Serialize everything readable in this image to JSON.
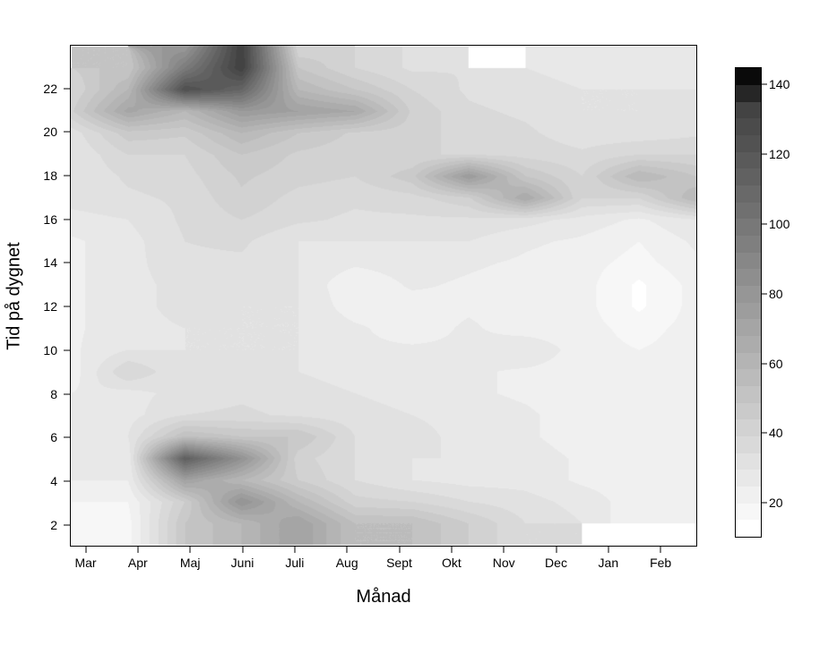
{
  "chart_data": {
    "type": "heatmap",
    "title": "",
    "xlabel": "Månad",
    "ylabel": "Tid på dygnet",
    "x_categories": [
      "Mar",
      "Apr",
      "Maj",
      "Juni",
      "Juli",
      "Aug",
      "Sept",
      "Okt",
      "Nov",
      "Dec",
      "Jan",
      "Feb"
    ],
    "y_ticks": [
      2,
      4,
      6,
      8,
      10,
      12,
      14,
      16,
      18,
      20,
      22
    ],
    "y_range": [
      1,
      24
    ],
    "legend_ticks": [
      20,
      40,
      60,
      80,
      100,
      120,
      140
    ],
    "legend_range": [
      10,
      145
    ],
    "grid": [
      [
        null,
        null,
        null,
        null,
        null,
        null,
        null,
        null,
        null,
        null,
        null,
        null
      ],
      [
        null,
        18,
        50,
        60,
        75,
        55,
        55,
        45,
        35,
        null,
        null,
        null
      ],
      [
        null,
        20,
        45,
        85,
        60,
        42,
        40,
        35,
        32,
        28,
        22,
        22
      ],
      [
        null,
        25,
        75,
        60,
        45,
        35,
        30,
        28,
        28,
        24,
        22,
        22
      ],
      [
        null,
        26,
        120,
        85,
        42,
        35,
        30,
        30,
        28,
        24,
        22,
        22
      ],
      [
        null,
        30,
        55,
        50,
        50,
        35,
        32,
        28,
        26,
        22,
        20,
        22
      ],
      [
        null,
        28,
        35,
        36,
        34,
        32,
        30,
        28,
        26,
        22,
        20,
        22
      ],
      [
        null,
        28,
        32,
        34,
        32,
        30,
        28,
        26,
        24,
        22,
        20,
        22
      ],
      [
        22,
        40,
        30,
        32,
        30,
        28,
        26,
        26,
        24,
        22,
        20,
        22
      ],
      [
        24,
        30,
        30,
        30,
        30,
        26,
        26,
        26,
        30,
        22,
        20,
        22
      ],
      [
        24,
        28,
        30,
        30,
        30,
        26,
        22,
        26,
        22,
        22,
        18,
        22
      ],
      [
        24,
        28,
        32,
        30,
        30,
        22,
        22,
        24,
        22,
        22,
        14,
        22
      ],
      [
        24,
        28,
        32,
        32,
        30,
        20,
        26,
        24,
        22,
        22,
        14,
        22
      ],
      [
        24,
        28,
        34,
        34,
        30,
        26,
        28,
        26,
        24,
        22,
        18,
        24
      ],
      [
        24,
        28,
        35,
        36,
        30,
        30,
        30,
        30,
        26,
        24,
        20,
        26
      ],
      [
        28,
        30,
        36,
        40,
        36,
        34,
        34,
        34,
        32,
        28,
        24,
        30
      ],
      [
        32,
        34,
        36,
        44,
        38,
        36,
        38,
        44,
        70,
        40,
        40,
        60
      ],
      [
        30,
        36,
        38,
        46,
        42,
        40,
        48,
        80,
        50,
        40,
        60,
        50
      ],
      [
        30,
        40,
        40,
        50,
        44,
        42,
        40,
        40,
        38,
        36,
        40,
        40
      ],
      [
        32,
        48,
        46,
        60,
        50,
        44,
        42,
        38,
        36,
        32,
        32,
        34
      ],
      [
        44,
        72,
        60,
        80,
        75,
        70,
        44,
        36,
        34,
        30,
        30,
        32
      ],
      [
        40,
        60,
        130,
        115,
        60,
        50,
        40,
        34,
        32,
        30,
        30,
        30
      ],
      [
        null,
        50,
        100,
        140,
        50,
        40,
        34,
        null,
        null,
        28,
        28,
        30
      ],
      [
        null,
        null,
        80,
        140,
        40,
        null,
        null,
        null,
        null,
        null,
        null,
        null
      ]
    ],
    "legend_levels": [
      10,
      15,
      20,
      25,
      30,
      35,
      40,
      45,
      50,
      55,
      60,
      65,
      70,
      75,
      80,
      85,
      90,
      95,
      100,
      105,
      110,
      115,
      120,
      125,
      130,
      135,
      140,
      145
    ],
    "legend_greys": [
      255,
      247,
      240,
      232,
      225,
      217,
      210,
      202,
      195,
      187,
      180,
      172,
      165,
      157,
      150,
      142,
      135,
      127,
      120,
      112,
      105,
      97,
      90,
      82,
      75,
      67,
      38,
      10
    ]
  }
}
